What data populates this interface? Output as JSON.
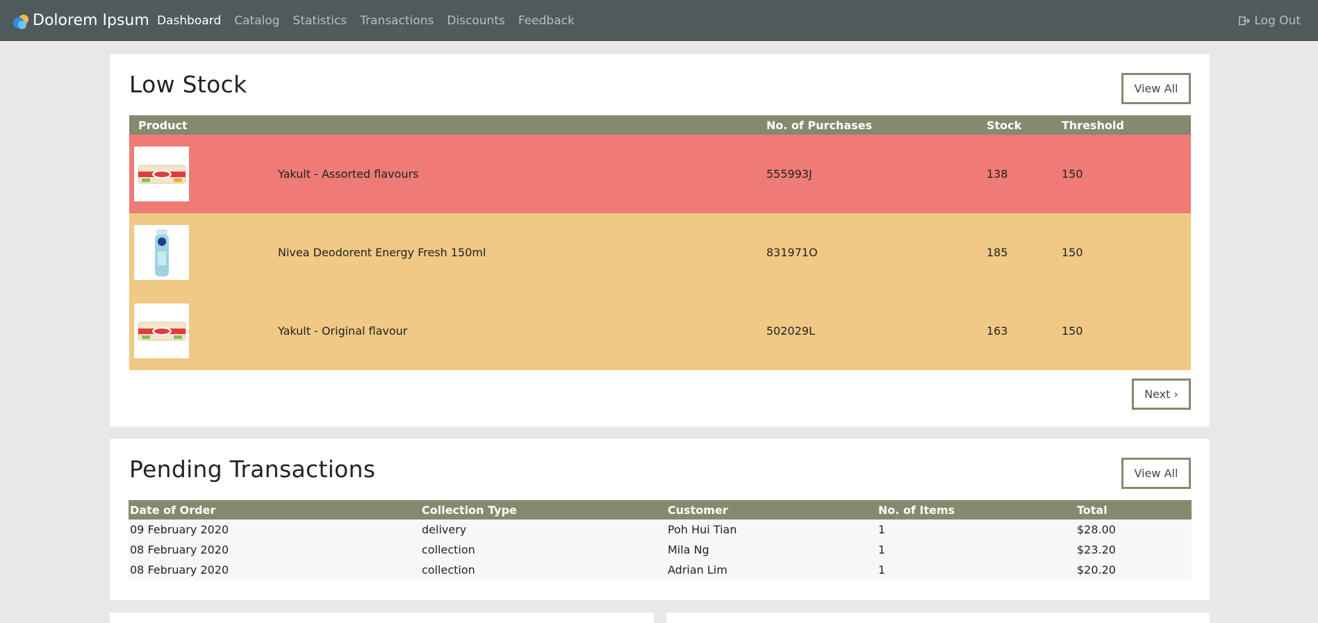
{
  "navbar": {
    "brand": "Dolorem Ipsum",
    "links": [
      "Dashboard",
      "Catalog",
      "Statistics",
      "Transactions",
      "Discounts",
      "Feedback"
    ],
    "active": "Dashboard",
    "logout": "Log Out"
  },
  "low_stock": {
    "title": "Low Stock",
    "view_all": "View All",
    "next": "Next ›",
    "headers": {
      "product": "Product",
      "purchases": "No. of Purchases",
      "stock": "Stock",
      "threshold": "Threshold"
    },
    "rows": [
      {
        "name": "Yakult - Assorted flavours",
        "purchases": "555993J",
        "stock": "138",
        "threshold": "150",
        "status": "critical"
      },
      {
        "name": "Nivea Deodorent Energy Fresh 150ml",
        "purchases": "831971O",
        "stock": "185",
        "threshold": "150",
        "status": "warning"
      },
      {
        "name": "Yakult - Original flavour",
        "purchases": "502029L",
        "stock": "163",
        "threshold": "150",
        "status": "warning"
      }
    ]
  },
  "pending": {
    "title": "Pending Transactions",
    "view_all": "View All",
    "headers": {
      "date": "Date of Order",
      "collection": "Collection Type",
      "customer": "Customer",
      "items": "No. of Items",
      "total": "Total"
    },
    "rows": [
      {
        "date": "09 February 2020",
        "collection": "delivery",
        "customer": "Poh Hui Tian",
        "items": "1",
        "total": "$28.00"
      },
      {
        "date": "08 February 2020",
        "collection": "collection",
        "customer": "Mila Ng",
        "items": "1",
        "total": "$23.20"
      },
      {
        "date": "08 February 2020",
        "collection": "collection",
        "customer": "Adrian Lim",
        "items": "1",
        "total": "$20.20"
      }
    ]
  },
  "colors": {
    "navbar": "#4f5a5a",
    "table_header": "#858a6f",
    "critical_row": "#ef7b76",
    "warning_row": "#efc985"
  }
}
